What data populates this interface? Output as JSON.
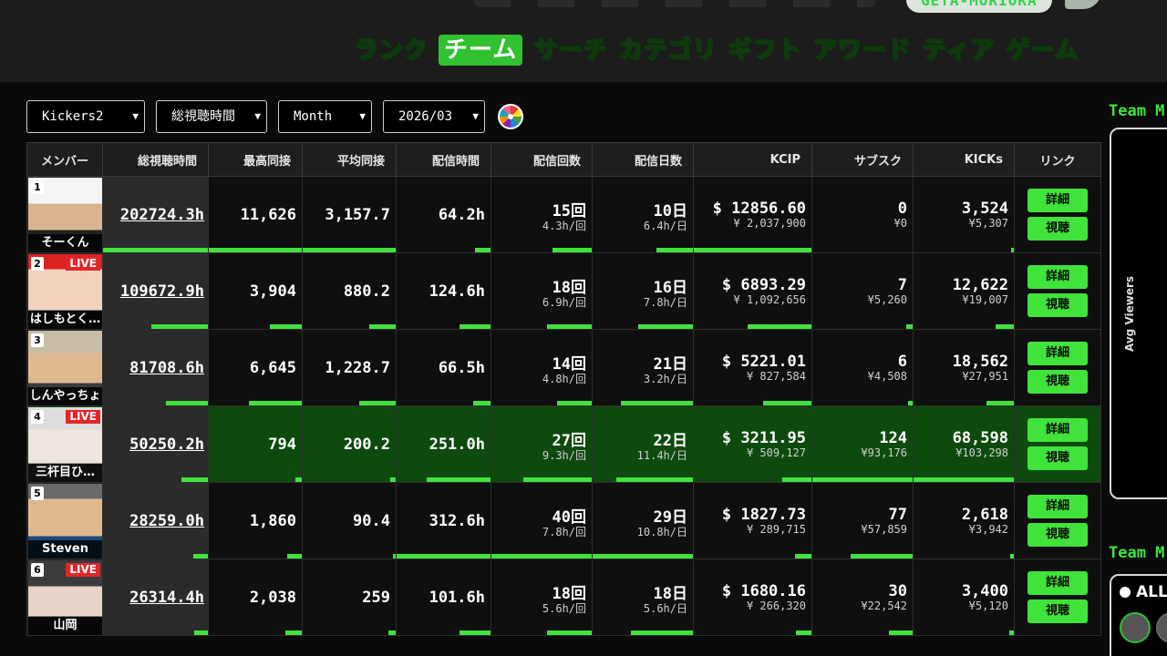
{
  "header": {
    "brand": "GETA-MORIOKA",
    "nav": [
      "ランク",
      "チーム",
      "サーチ",
      "カテゴリ",
      "ギフト",
      "アワード",
      "ティア",
      "ゲーム"
    ],
    "active_tab": "チーム"
  },
  "filters": {
    "team": "Kickers2",
    "metric": "総視聴時間",
    "period": "Month",
    "date": "2026/03"
  },
  "table": {
    "headers": [
      "メンバー",
      "総視聴時間",
      "最高同接",
      "平均同接",
      "配信時間",
      "配信回数",
      "配信日数",
      "KCIP",
      "サブスク",
      "KICKs",
      "リンク"
    ],
    "rows": [
      {
        "rank": "1",
        "name": "そーくん",
        "live": "",
        "total": "202724.3h",
        "peak": "11,626",
        "avg": "3,157.7",
        "hours": "64.2h",
        "streams": "15回",
        "streams_sub": "4.3h/回",
        "days": "10日",
        "days_sub": "6.4h/日",
        "kcip": "$ 12856.60",
        "kcip_sub": "¥ 2,037,900",
        "subs": "0",
        "subs_sub": "¥0",
        "kicks": "3,524",
        "kicks_sub": "¥5,307",
        "btn1": "詳細",
        "btn2": "視聴",
        "fill": [
          1.0,
          1.0,
          1.0,
          0.17,
          0.39,
          0.36,
          1.0,
          0.0,
          0.03
        ]
      },
      {
        "rank": "2",
        "name": "はしもとく…",
        "live": "LIVE",
        "total": "109672.9h",
        "peak": "3,904",
        "avg": "880.2",
        "hours": "124.6h",
        "streams": "18回",
        "streams_sub": "6.9h/回",
        "days": "16日",
        "days_sub": "7.8h/日",
        "kcip": "$ 6893.29",
        "kcip_sub": "¥ 1,092,656",
        "subs": "7",
        "subs_sub": "¥5,260",
        "kicks": "12,622",
        "kicks_sub": "¥19,007",
        "btn1": "詳細",
        "btn2": "視聴",
        "fill": [
          0.54,
          0.34,
          0.28,
          0.33,
          0.45,
          0.55,
          0.54,
          0.06,
          0.18
        ]
      },
      {
        "rank": "3",
        "name": "しんやっちょ",
        "live": "",
        "total": "81708.6h",
        "peak": "6,645",
        "avg": "1,228.7",
        "hours": "66.5h",
        "streams": "14回",
        "streams_sub": "4.8h/回",
        "days": "21日",
        "days_sub": "3.2h/日",
        "kcip": "$ 5221.01",
        "kcip_sub": "¥ 827,584",
        "subs": "6",
        "subs_sub": "¥4,508",
        "kicks": "18,562",
        "kicks_sub": "¥27,951",
        "btn1": "詳細",
        "btn2": "視聴",
        "fill": [
          0.4,
          0.57,
          0.39,
          0.18,
          0.35,
          0.72,
          0.41,
          0.05,
          0.27
        ]
      },
      {
        "rank": "4",
        "name": "三杆目ひ…",
        "live": "LIVE",
        "total": "50250.2h",
        "peak": "794",
        "avg": "200.2",
        "hours": "251.0h",
        "streams": "27回",
        "streams_sub": "9.3h/回",
        "days": "22日",
        "days_sub": "11.4h/日",
        "kcip": "$ 3211.95",
        "kcip_sub": "¥ 509,127",
        "subs": "124",
        "subs_sub": "¥93,176",
        "kicks": "68,598",
        "kicks_sub": "¥103,298",
        "btn1": "詳細",
        "btn2": "視聴",
        "fill": [
          0.25,
          0.07,
          0.06,
          0.68,
          0.68,
          0.76,
          0.25,
          1.0,
          1.0
        ]
      },
      {
        "rank": "5",
        "name": "Steven",
        "live": "",
        "total": "28259.0h",
        "peak": "1,860",
        "avg": "90.4",
        "hours": "312.6h",
        "streams": "40回",
        "streams_sub": "7.8h/回",
        "days": "29日",
        "days_sub": "10.8h/日",
        "kcip": "$ 1827.73",
        "kcip_sub": "¥ 289,715",
        "subs": "77",
        "subs_sub": "¥57,859",
        "kicks": "2,618",
        "kicks_sub": "¥3,942",
        "btn1": "詳細",
        "btn2": "視聴",
        "fill": [
          0.14,
          0.16,
          0.03,
          1.0,
          1.0,
          1.0,
          0.14,
          0.62,
          0.04
        ]
      },
      {
        "rank": "6",
        "name": "山岡",
        "live": "LIVE",
        "total": "26314.4h",
        "peak": "2,038",
        "avg": "259",
        "hours": "101.6h",
        "streams": "18回",
        "streams_sub": "5.6h/回",
        "days": "18日",
        "days_sub": "5.6h/日",
        "kcip": "$ 1680.16",
        "kcip_sub": "¥ 266,320",
        "subs": "30",
        "subs_sub": "¥22,542",
        "kicks": "3,400",
        "kicks_sub": "¥5,120",
        "btn1": "詳細",
        "btn2": "視聴",
        "fill": [
          0.13,
          0.18,
          0.08,
          0.33,
          0.45,
          0.62,
          0.13,
          0.24,
          0.05
        ]
      }
    ]
  },
  "side": {
    "title1": "Team M",
    "vertical_label": "Avg Viewers",
    "title2": "Team M",
    "radio_label": "ALL"
  },
  "colors": {
    "accent": "#42e23e",
    "highlight_row": "#0e4a0e",
    "live": "#e3262b"
  }
}
